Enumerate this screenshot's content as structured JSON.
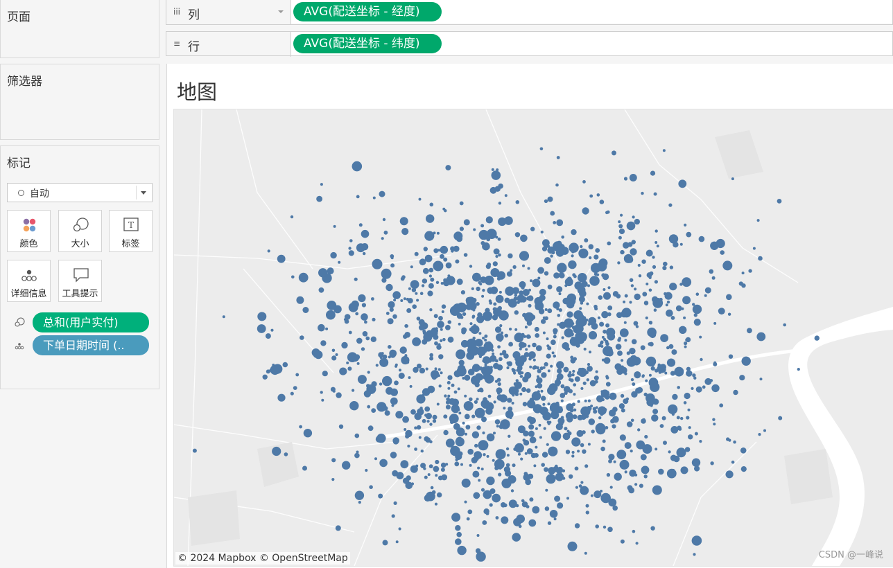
{
  "left": {
    "pages_title": "页面",
    "filters_title": "筛选器",
    "marks_title": "标记",
    "marks_type": "自动",
    "mark_buttons": [
      "颜色",
      "大小",
      "标签",
      "详细信息",
      "工具提示"
    ],
    "mark_pills": [
      {
        "label": "总和(用户实付)",
        "encoding": "size-icon",
        "color": "#00b07b"
      },
      {
        "label": "下单日期时间 (..",
        "encoding": "detail-icon",
        "color": "#4a9bbd"
      }
    ]
  },
  "shelves": {
    "columns": {
      "icon": "iii",
      "name": "列",
      "pill": "AVG(配送坐标 - 经度)"
    },
    "rows": {
      "icon": "≡",
      "name": "行",
      "pill": "AVG(配送坐标 - 纬度)"
    }
  },
  "view": {
    "title": "地图",
    "attribution": "© 2024 Mapbox © OpenStreetMap",
    "watermark": "CSDN @一峰说"
  },
  "colors": {
    "pill_green": "#00a86b",
    "pill_blue": "#4a9bbd",
    "point_color": "#4e79a7",
    "map_background": "#ececec",
    "river": "#ffffff"
  },
  "map_legend": {
    "mark_type": "circle",
    "point_count_approx": 1500
  }
}
